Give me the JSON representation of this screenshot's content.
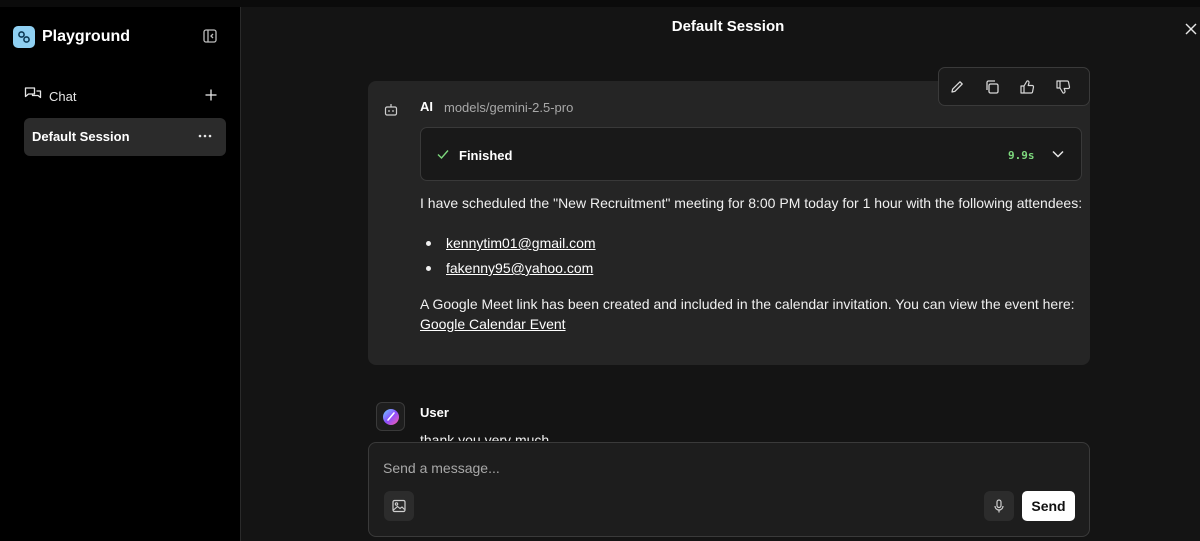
{
  "app": {
    "title": "Playground"
  },
  "sidebar": {
    "chat_label": "Chat",
    "sessions": [
      {
        "label": "Default Session"
      }
    ]
  },
  "header": {
    "title": "Default Session"
  },
  "ai_message": {
    "sender": "AI",
    "model": "models/gemini-2.5-pro",
    "status": {
      "label": "Finished",
      "duration": "9.9s"
    },
    "paragraph1": "I have scheduled the \"New Recruitment\" meeting for 8:00 PM today for 1 hour with the following attendees:",
    "attendees": [
      "kennytim01@gmail.com",
      "fakenny95@yahoo.com"
    ],
    "paragraph2": "A Google Meet link has been created and included in the calendar invitation. You can view the event here:",
    "link_text": "Google Calendar Event"
  },
  "user_message": {
    "sender": "User",
    "text": "thank you very much"
  },
  "composer": {
    "placeholder": "Send a message...",
    "send_label": "Send"
  },
  "colors": {
    "accent_logo": "#8fd0f2",
    "status_time": "#7dd87d",
    "session_active_bg": "#2b2b2b"
  }
}
